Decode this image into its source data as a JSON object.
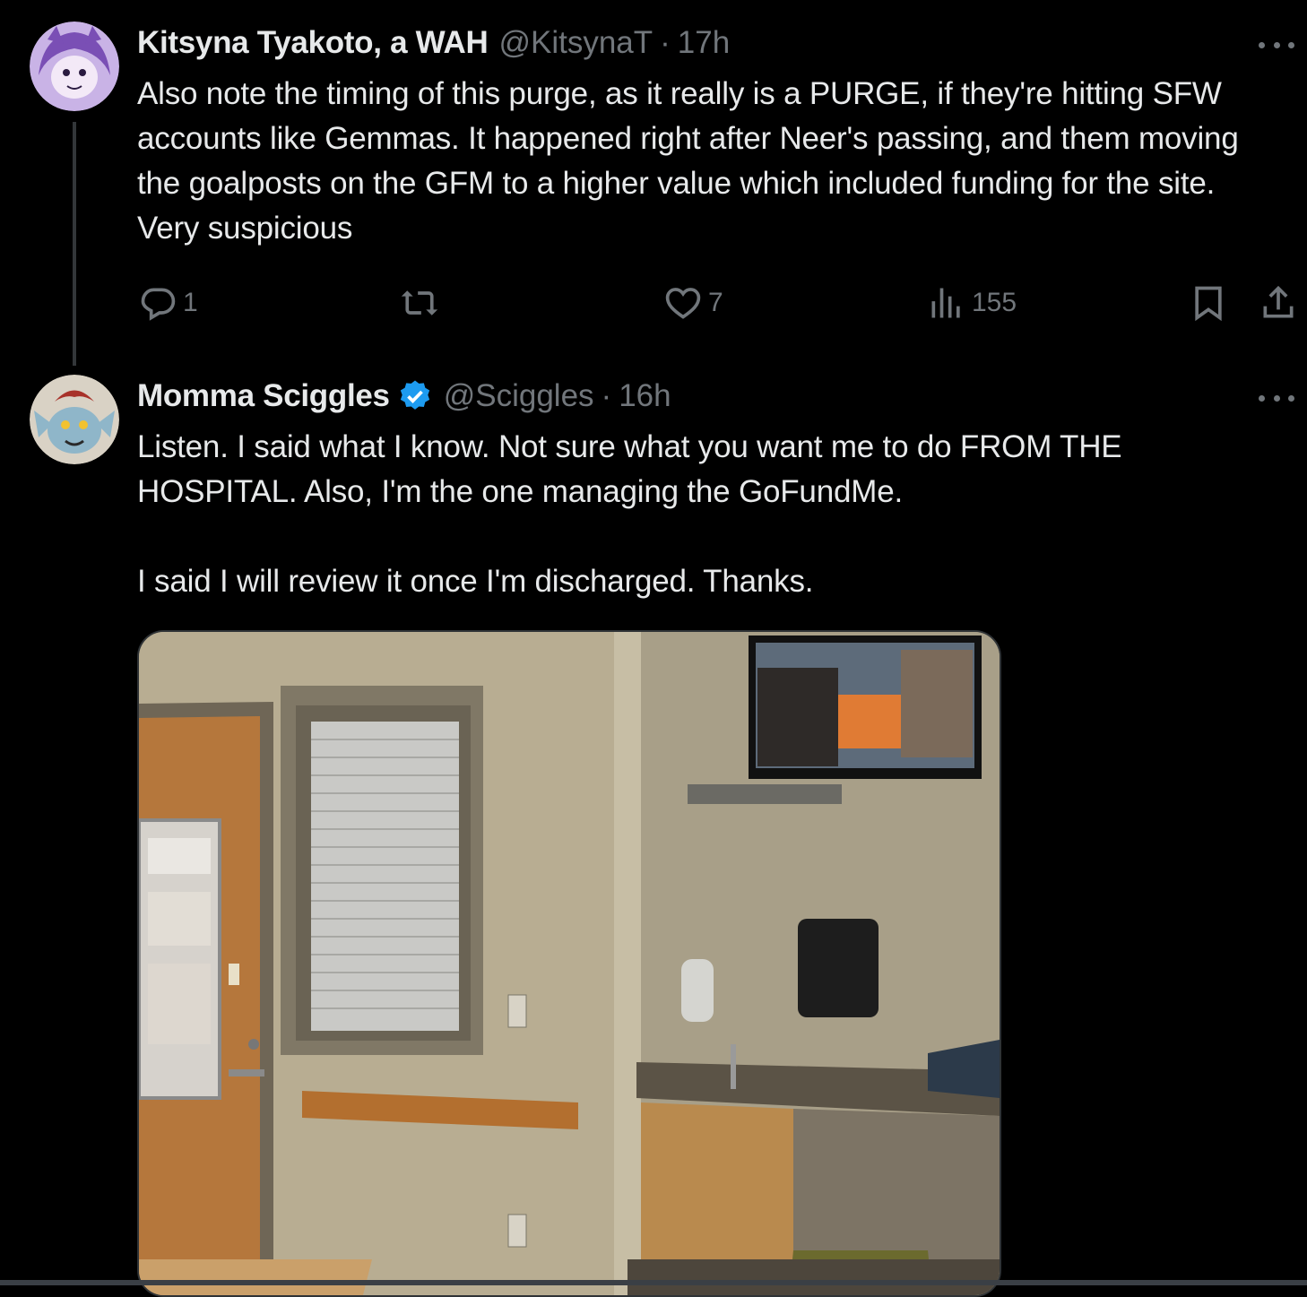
{
  "tweets": [
    {
      "name": "Kitsyna Tyakoto, a WAH",
      "handle": "@KitsynaT",
      "separator": "·",
      "time": "17h",
      "text": "Also note the timing of this purge, as it really is a PURGE, if they're hitting SFW accounts like Gemmas. It happened right after Neer's passing, and them moving the goalposts on the GFM to a higher value which included funding for the site. Very suspicious",
      "replies": "1",
      "reposts": "",
      "likes": "7",
      "views": "155",
      "avatar_color": "#9b6fc9"
    },
    {
      "name": "Momma Sciggles",
      "verified": true,
      "handle": "@Sciggles",
      "separator": "·",
      "time": "16h",
      "text": "Listen. I said what I know. Not sure what you want me to do FROM THE HOSPITAL. Also, I'm the one managing the GoFundMe.\n\nI said I will review it once I'm discharged. Thanks.",
      "avatar_color": "#8fb6c9"
    }
  ],
  "icons": {
    "reply": "reply-icon",
    "repost": "repost-icon",
    "like": "heart-icon",
    "views": "views-icon",
    "bookmark": "bookmark-icon",
    "share": "share-icon",
    "more": "more-icon",
    "verified": "verified-badge-icon"
  },
  "colors": {
    "background": "#000000",
    "text": "#e7e9ea",
    "secondary": "#71767b",
    "verified": "#1d9bf0"
  }
}
